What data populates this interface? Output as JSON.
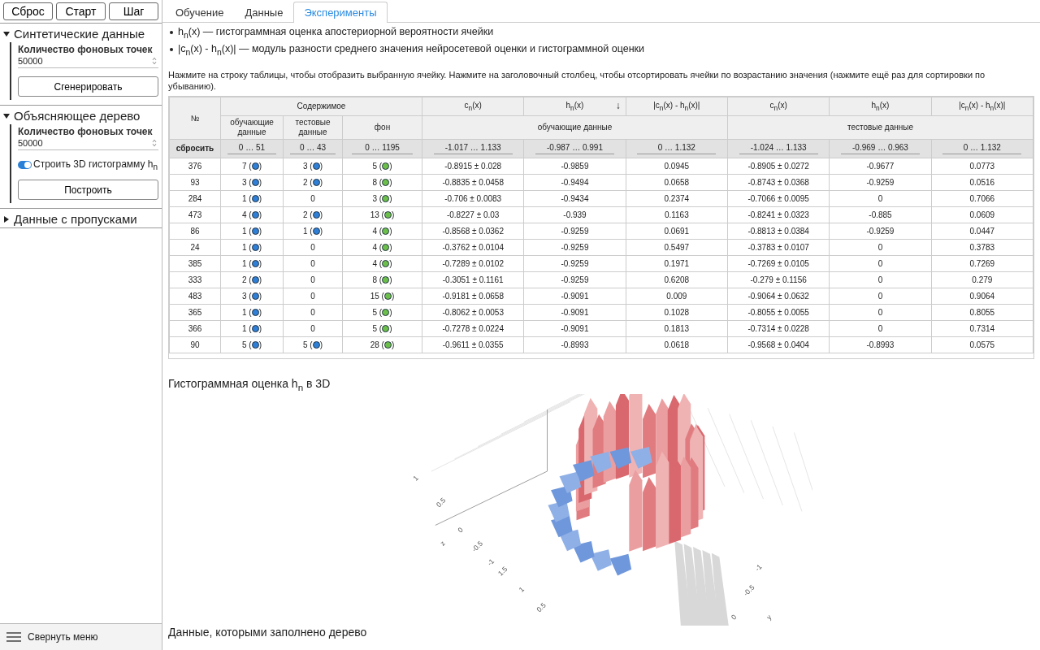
{
  "sidebar": {
    "buttons": [
      "Сброс",
      "Старт",
      "Шаг"
    ],
    "sections": [
      {
        "title": "Синтетические данные",
        "expanded": true,
        "fields": [
          {
            "kind": "number",
            "label": "Количество фоновых точек",
            "value": "50000"
          },
          {
            "kind": "button",
            "label": "Сгенерировать"
          }
        ]
      },
      {
        "title": "Объясняющее дерево",
        "expanded": true,
        "fields": [
          {
            "kind": "number",
            "label": "Количество фоновых точек",
            "value": "50000"
          },
          {
            "kind": "toggle",
            "label": "Строить 3D гистограмму h$_{n}$",
            "on": true
          },
          {
            "kind": "button",
            "label": "Построить"
          }
        ]
      },
      {
        "title": "Данные с пропусками",
        "expanded": false
      }
    ],
    "footer": "Свернуть меню"
  },
  "tabs": [
    {
      "label": "Обучение",
      "selected": false
    },
    {
      "label": "Данные",
      "selected": false
    },
    {
      "label": "Эксперименты",
      "selected": true
    }
  ],
  "legend": [
    "h$_{n}$(x) — гистограммная оценка апостериорной вероятности ячейки",
    "|c$_{n}$(x) - h$_{n}$(x)| — модуль разности среднего значения нейросетевой оценки и гистограммной оценки"
  ],
  "hint": "Нажмите на строку таблицы, чтобы отобразить выбранную ячейку. Нажмите на заголовочный столбец, чтобы отсортировать ячейки по возрастанию значения (нажмите ещё раз для сортировки по убыванию).",
  "table": {
    "no_header": "№",
    "content_header": "Содержимое",
    "content_cols": [
      "обучающие данные",
      "тестовые данные",
      "фон"
    ],
    "groups": [
      {
        "title": "обучающие данные",
        "cols": [
          {
            "label": "c$_{n}$(x)"
          },
          {
            "label": "h$_{n}$(x)",
            "sort": "↓"
          },
          {
            "label": "|c$_{n}$(x) - h$_{n}$(x)|"
          }
        ]
      },
      {
        "title": "тестовые данные",
        "cols": [
          {
            "label": "c$_{n}$(x)"
          },
          {
            "label": "h$_{n}$(x)"
          },
          {
            "label": "|c$_{n}$(x) - h$_{n}$(x)|"
          }
        ]
      }
    ],
    "reset": "сбросить",
    "ranges": [
      "0 … 51",
      "0 … 43",
      "0 … 1195",
      "-1.017 … 1.133",
      "-0.987 … 0.991",
      "0 … 1.132",
      "-1.024 … 1.133",
      "-0.969 … 0.963",
      "0 … 1.132"
    ],
    "rows": [
      {
        "no": "376",
        "counts": [
          {
            "text": "7 (",
            "close": ")",
            "color": "#2f7fd6"
          },
          {
            "text": "3 (",
            "close": ")",
            "color": "#2f7fd6"
          },
          {
            "text": "5 (",
            "close": ")",
            "color": "#6cc04a"
          }
        ],
        "values": [
          "-0.8915 ± 0.028",
          "-0.9859",
          "0.0945",
          "-0.8905 ± 0.0272",
          "-0.9677",
          "0.0773"
        ]
      },
      {
        "no": "93",
        "counts": [
          {
            "text": "3 (",
            "close": ")",
            "color": "#2f7fd6"
          },
          {
            "text": "2 (",
            "close": ")",
            "color": "#2f7fd6"
          },
          {
            "text": "8 (",
            "close": ")",
            "color": "#6cc04a"
          }
        ],
        "values": [
          "-0.8835 ± 0.0458",
          "-0.9494",
          "0.0658",
          "-0.8743 ± 0.0368",
          "-0.9259",
          "0.0516"
        ]
      },
      {
        "no": "284",
        "counts": [
          {
            "text": "1 (",
            "close": ")",
            "color": "#2f7fd6"
          },
          {
            "text": "0"
          },
          {
            "text": "3 (",
            "close": ")",
            "color": "#6cc04a"
          }
        ],
        "values": [
          "-0.706 ± 0.0083",
          "-0.9434",
          "0.2374",
          "-0.7066 ± 0.0095",
          "0",
          "0.7066"
        ]
      },
      {
        "no": "473",
        "counts": [
          {
            "text": "4 (",
            "close": ")",
            "color": "#2f7fd6"
          },
          {
            "text": "2 (",
            "close": ")",
            "color": "#2f7fd6"
          },
          {
            "text": "13 (",
            "close": ")",
            "color": "#6cc04a"
          }
        ],
        "values": [
          "-0.8227 ± 0.03",
          "-0.939",
          "0.1163",
          "-0.8241 ± 0.0323",
          "-0.885",
          "0.0609"
        ]
      },
      {
        "no": "86",
        "counts": [
          {
            "text": "1 (",
            "close": ")",
            "color": "#2f7fd6"
          },
          {
            "text": "1 (",
            "close": ")",
            "color": "#2f7fd6"
          },
          {
            "text": "4 (",
            "close": ")",
            "color": "#6cc04a"
          }
        ],
        "values": [
          "-0.8568 ± 0.0362",
          "-0.9259",
          "0.0691",
          "-0.8813 ± 0.0384",
          "-0.9259",
          "0.0447"
        ]
      },
      {
        "no": "24",
        "counts": [
          {
            "text": "1 (",
            "close": ")",
            "color": "#2f7fd6"
          },
          {
            "text": "0"
          },
          {
            "text": "4 (",
            "close": ")",
            "color": "#6cc04a"
          }
        ],
        "values": [
          "-0.3762 ± 0.0104",
          "-0.9259",
          "0.5497",
          "-0.3783 ± 0.0107",
          "0",
          "0.3783"
        ]
      },
      {
        "no": "385",
        "counts": [
          {
            "text": "1 (",
            "close": ")",
            "color": "#2f7fd6"
          },
          {
            "text": "0"
          },
          {
            "text": "4 (",
            "close": ")",
            "color": "#6cc04a"
          }
        ],
        "values": [
          "-0.7289 ± 0.0102",
          "-0.9259",
          "0.1971",
          "-0.7269 ± 0.0105",
          "0",
          "0.7269"
        ]
      },
      {
        "no": "333",
        "counts": [
          {
            "text": "2 (",
            "close": ")",
            "color": "#2f7fd6"
          },
          {
            "text": "0"
          },
          {
            "text": "8 (",
            "close": ")",
            "color": "#6cc04a"
          }
        ],
        "values": [
          "-0.3051 ± 0.1161",
          "-0.9259",
          "0.6208",
          "-0.279 ± 0.1156",
          "0",
          "0.279"
        ]
      },
      {
        "no": "483",
        "counts": [
          {
            "text": "3 (",
            "close": ")",
            "color": "#2f7fd6"
          },
          {
            "text": "0"
          },
          {
            "text": "15 (",
            "close": ")",
            "color": "#6cc04a"
          }
        ],
        "values": [
          "-0.9181 ± 0.0658",
          "-0.9091",
          "0.009",
          "-0.9064 ± 0.0632",
          "0",
          "0.9064"
        ]
      },
      {
        "no": "365",
        "counts": [
          {
            "text": "1 (",
            "close": ")",
            "color": "#2f7fd6"
          },
          {
            "text": "0"
          },
          {
            "text": "5 (",
            "close": ")",
            "color": "#6cc04a"
          }
        ],
        "values": [
          "-0.8062 ± 0.0053",
          "-0.9091",
          "0.1028",
          "-0.8055 ± 0.0055",
          "0",
          "0.8055"
        ]
      },
      {
        "no": "366",
        "counts": [
          {
            "text": "1 (",
            "close": ")",
            "color": "#2f7fd6"
          },
          {
            "text": "0"
          },
          {
            "text": "5 (",
            "close": ")",
            "color": "#6cc04a"
          }
        ],
        "values": [
          "-0.7278 ± 0.0224",
          "-0.9091",
          "0.1813",
          "-0.7314 ± 0.0228",
          "0",
          "0.7314"
        ]
      },
      {
        "no": "90",
        "counts": [
          {
            "text": "5 (",
            "close": ")",
            "color": "#2f7fd6"
          },
          {
            "text": "5 (",
            "close": ")",
            "color": "#2f7fd6"
          },
          {
            "text": "28 (",
            "close": ")",
            "color": "#6cc04a"
          }
        ],
        "values": [
          "-0.9611 ± 0.0355",
          "-0.8993",
          "0.0618",
          "-0.9568 ± 0.0404",
          "-0.8993",
          "0.0575"
        ]
      }
    ]
  },
  "plot": {
    "title": "Гистограммная оценка h$_{n}$ в 3D",
    "ticks": [
      "1",
      "0.5",
      "0",
      "z",
      "-0.5",
      "-1",
      "1.5",
      "1",
      "0.5",
      "-1",
      "-0.5",
      "0",
      "y"
    ]
  },
  "next_heading": "Данные, которыми заполнено дерево"
}
